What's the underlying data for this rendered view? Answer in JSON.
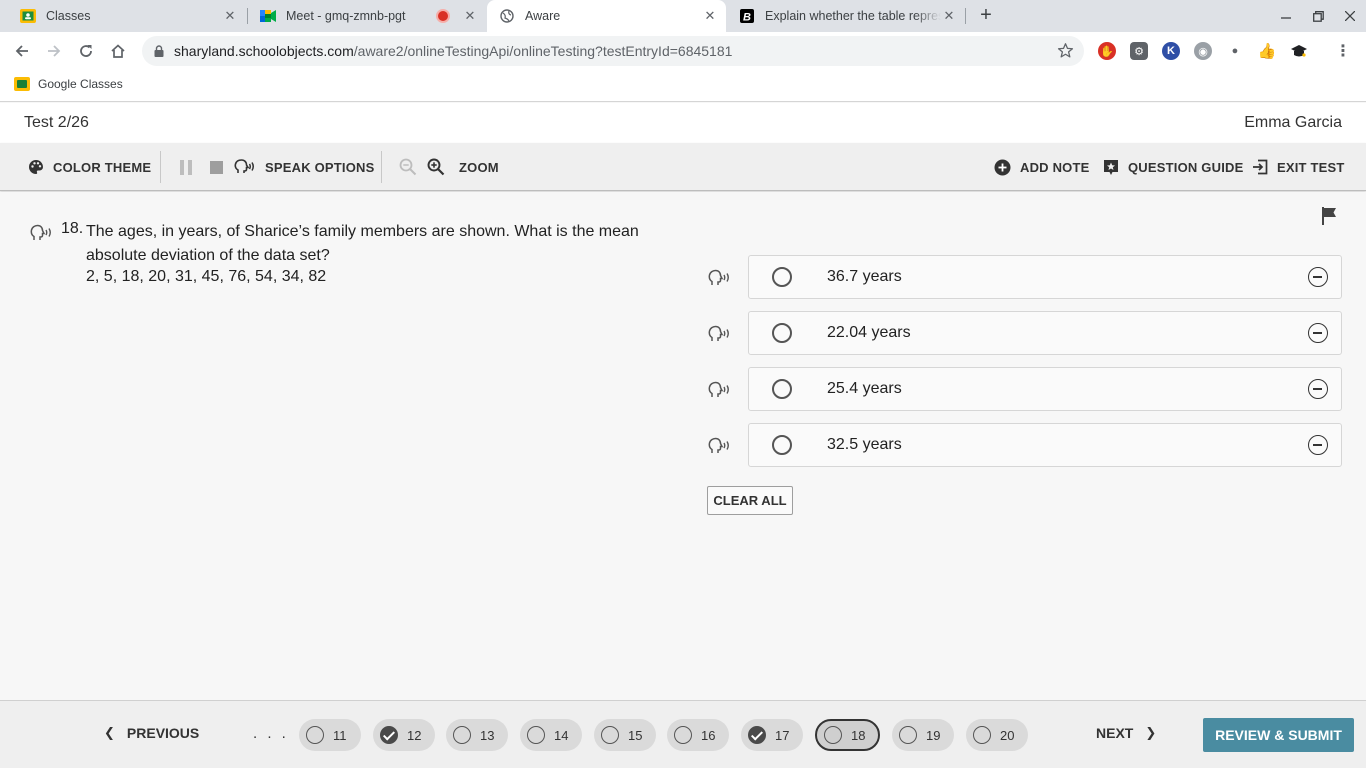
{
  "browser": {
    "tabs": [
      {
        "title": "Classes",
        "favicon": "google-classroom-icon"
      },
      {
        "title": "Meet - gmq-zmnb-pgt",
        "favicon": "google-meet-icon",
        "recording": true
      },
      {
        "title": "Aware",
        "favicon": "globe-icon",
        "active": true
      },
      {
        "title": "Explain whether the table represents",
        "favicon": "brainly-icon"
      }
    ],
    "url_host": "sharyland.schoolobjects.com",
    "url_path": "/aware2/onlineTestingApi/onlineTesting?testEntryId=6845181",
    "bookmarks": [
      {
        "label": "Google Classes"
      }
    ]
  },
  "app": {
    "test_name": "Test 2/26",
    "student_name": "Emma Garcia"
  },
  "tools": {
    "color_theme": "COLOR THEME",
    "speak_options": "SPEAK OPTIONS",
    "zoom": "ZOOM",
    "add_note": "ADD NOTE",
    "question_guide": "QUESTION GUIDE",
    "exit_test": "EXIT TEST"
  },
  "question": {
    "number": "18.",
    "text": "The ages, in years, of Sharice’s family members are shown. What is the mean absolute deviation of the data set?",
    "data": "2, 5, 18, 20, 31, 45, 76, 54, 34, 82",
    "options": [
      {
        "text": "36.7 years",
        "selected": false
      },
      {
        "text": "22.04 years",
        "selected": false
      },
      {
        "text": "25.4 years",
        "selected": false
      },
      {
        "text": "32.5 years",
        "selected": false
      }
    ],
    "clear_all": "CLEAR ALL"
  },
  "navigation": {
    "previous": "PREVIOUS",
    "next": "NEXT",
    "ellipsis": ". . .",
    "review_submit": "REVIEW & SUBMIT",
    "questions": [
      {
        "num": "11",
        "answered": false,
        "current": false
      },
      {
        "num": "12",
        "answered": true,
        "current": false
      },
      {
        "num": "13",
        "answered": false,
        "current": false
      },
      {
        "num": "14",
        "answered": false,
        "current": false
      },
      {
        "num": "15",
        "answered": false,
        "current": false
      },
      {
        "num": "16",
        "answered": false,
        "current": false
      },
      {
        "num": "17",
        "answered": true,
        "current": false
      },
      {
        "num": "18",
        "answered": false,
        "current": true
      },
      {
        "num": "19",
        "answered": false,
        "current": false
      },
      {
        "num": "20",
        "answered": false,
        "current": false
      }
    ]
  },
  "colors": {
    "submit_bg": "#4a8ca1",
    "tabstrip_bg": "#dee1e6",
    "toolbar_bg": "#efefef"
  }
}
